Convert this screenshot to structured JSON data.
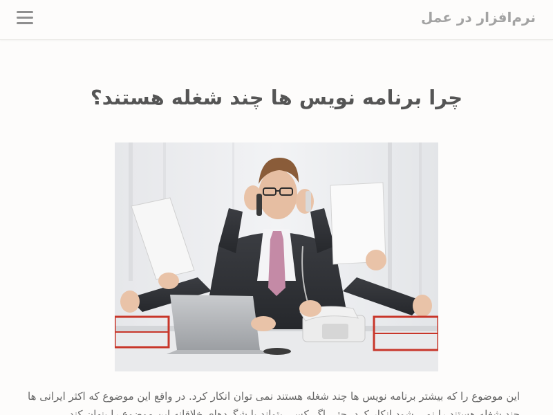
{
  "header": {
    "site_title": "نرم‌افزار در عمل",
    "menu_icon": "hamburger-menu-icon"
  },
  "post": {
    "title": "چرا برنامه نویس ها چند شغله هستند؟",
    "image_icon": "multitasking-businessman-photo",
    "excerpt": "این موضوع را که بیشتر برنامه نویس ها چند شغله هستند نمی توان انکار کرد. در واقع این موضوع که اکثر ایرانی ها چند شغله هستند را نمی شود انکار کرد. حتی اگر کسی بتواند با شگردهای خلاقانه این موضوع را پنهان کند"
  },
  "colors": {
    "background": "#fdfcfb",
    "title_text": "#555555",
    "header_text": "#a3a3a3",
    "body_text": "#666666"
  }
}
